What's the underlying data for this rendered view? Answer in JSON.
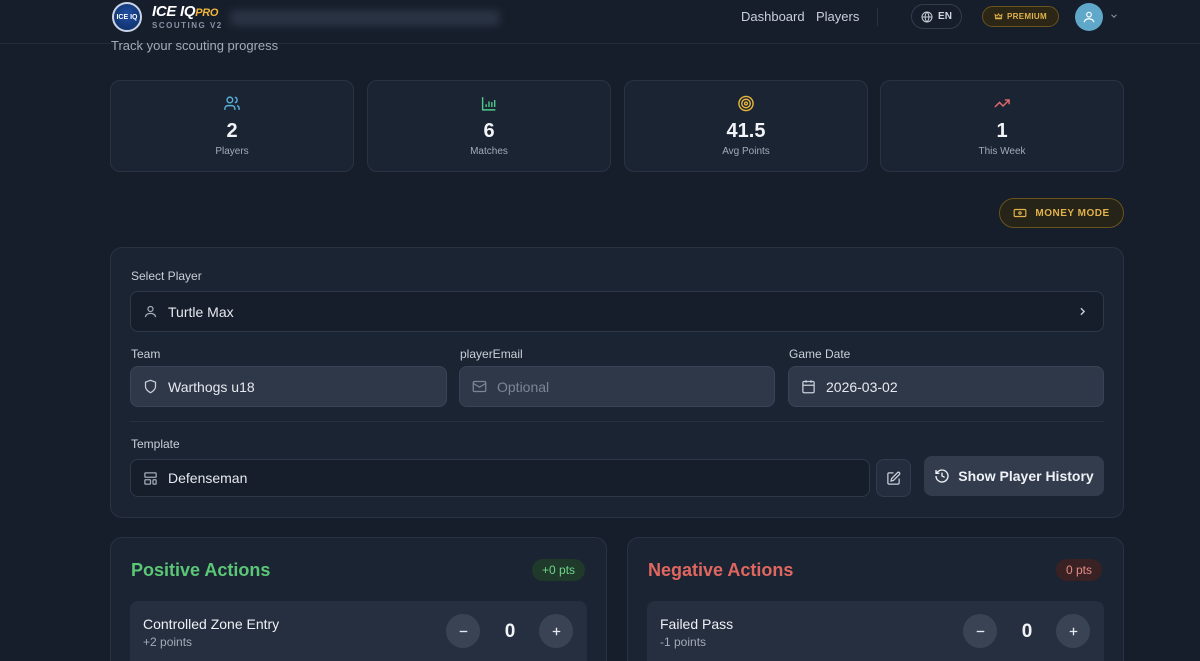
{
  "header": {
    "logo_brand": "ICE IQ",
    "logo_pro": "PRO",
    "logo_badge": "ICE IQ",
    "logo_sub": "SCOUTING V2",
    "nav": [
      "Dashboard",
      "Players"
    ],
    "lang": "EN",
    "premium": "PREMIUM"
  },
  "page": {
    "subtitle": "Track your scouting progress"
  },
  "stats": [
    {
      "icon": "users-icon",
      "value": "2",
      "label": "Players"
    },
    {
      "icon": "bar-chart-icon",
      "value": "6",
      "label": "Matches"
    },
    {
      "icon": "target-icon",
      "value": "41.5",
      "label": "Avg Points"
    },
    {
      "icon": "trending-up-icon",
      "value": "1",
      "label": "This Week"
    }
  ],
  "money_mode": "MONEY MODE",
  "form": {
    "select_player_label": "Select Player",
    "player_value": "Turtle Max",
    "team_label": "Team",
    "team_value": "Warthogs u18",
    "email_label": "playerEmail",
    "email_placeholder": "Optional",
    "date_label": "Game Date",
    "date_value": "2026-03-02",
    "template_label": "Template",
    "template_value": "Defenseman",
    "history_button": "Show Player History"
  },
  "positive": {
    "title": "Positive Actions",
    "badge": "+0 pts",
    "items": [
      {
        "name": "Controlled Zone Entry",
        "points": "+2 points",
        "count": "0"
      }
    ]
  },
  "negative": {
    "title": "Negative Actions",
    "badge": "0 pts",
    "items": [
      {
        "name": "Failed Pass",
        "points": "-1 points",
        "count": "0"
      }
    ]
  },
  "colors": {
    "accent_gold": "#e2b24a",
    "positive": "#5bc776",
    "negative": "#e0675f",
    "stat_icon_users": "#5ab0d9",
    "stat_icon_chart": "#4ec98a",
    "stat_icon_target": "#e8b53a",
    "stat_icon_trend": "#e36a6a"
  }
}
